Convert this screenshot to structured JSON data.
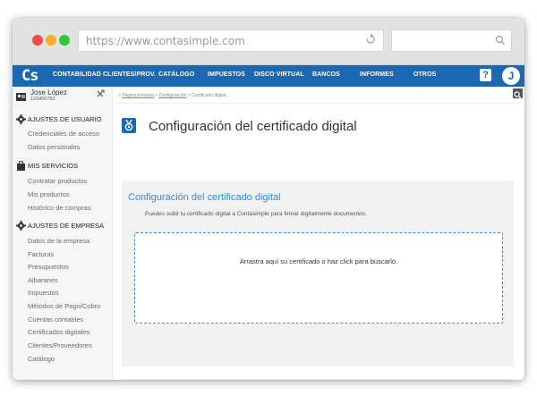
{
  "browser": {
    "url": "https://www.contasimple.com"
  },
  "nav": {
    "logo": "Cs",
    "items": [
      {
        "label": "CONTABILIDAD"
      },
      {
        "label": "CLIENTES/PROV."
      },
      {
        "label": "CATÁLOGO"
      },
      {
        "label": "IMPUESTOS"
      },
      {
        "label": "DISCO VIRTUAL"
      },
      {
        "label": "BANCOS"
      },
      {
        "label": "INFORMES"
      },
      {
        "label": "OTROS"
      }
    ],
    "help": "?",
    "avatar": "J"
  },
  "user": {
    "name": "Jose López",
    "id": "123456782"
  },
  "sidebar": {
    "sections": [
      {
        "title": "AJUSTES DE USUARIO",
        "icon": "gear-icon",
        "items": [
          {
            "label": "Credenciales de acceso"
          },
          {
            "label": "Datos personales"
          }
        ]
      },
      {
        "title": "MIS SERVICIOS",
        "icon": "bag-icon",
        "items": [
          {
            "label": "Contratar productos"
          },
          {
            "label": "Mis productos"
          },
          {
            "label": "Histórico de compras"
          }
        ]
      },
      {
        "title": "AJUSTES DE EMPRESA",
        "icon": "gear-icon",
        "items": [
          {
            "label": "Datos de la empresa"
          },
          {
            "label": "Facturas"
          },
          {
            "label": "Presupuestos"
          },
          {
            "label": "Albaranes"
          },
          {
            "label": "Impuestos"
          },
          {
            "label": "Métodos de Pago/Cobro"
          },
          {
            "label": "Cuentas contables"
          },
          {
            "label": "Certificados digitales"
          },
          {
            "label": "Clientes/Proveedores"
          },
          {
            "label": "Catálogo"
          }
        ]
      }
    ]
  },
  "breadcrumb": {
    "home": "Página principal",
    "config": "Configuración",
    "current": "Certificado digital",
    "separator": ">"
  },
  "page": {
    "title": "Configuración del certificado digital"
  },
  "panel": {
    "title": "Configuración del certificado digital",
    "description": "Puedes subir tu certificado digital a Contasimple para firmar digitalmente documentos.",
    "dropzone_text": "Arrastra aquí su certificado o haz click para buscarlo."
  },
  "colors": {
    "brand": "#1a68b3",
    "accent": "#3d8ad3"
  }
}
